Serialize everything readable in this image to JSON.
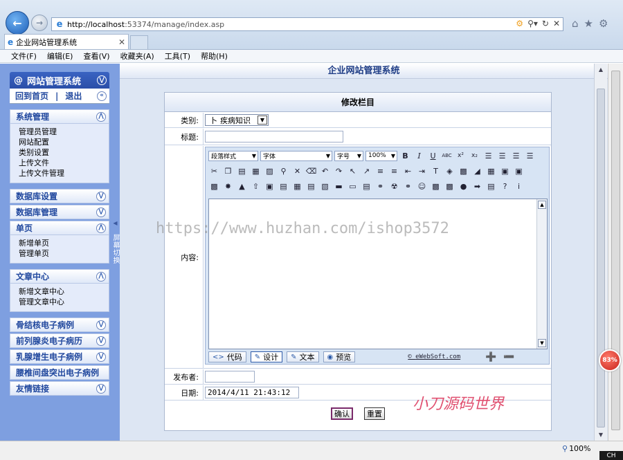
{
  "browser": {
    "url_host": "http://localhost",
    "url_rest": ":53374/manage/index.asp",
    "tab_title": "企业网站管理系统",
    "menu": [
      "文件(F)",
      "编辑(E)",
      "查看(V)",
      "收藏夹(A)",
      "工具(T)",
      "帮助(H)"
    ],
    "zoom": "100%",
    "lang": "CH",
    "progress_badge": "83%"
  },
  "sidebar": {
    "system_title": "网站管理系统",
    "home": "回到首页",
    "separator": "|",
    "logout": "退出",
    "splitter_label": "屏幕切换",
    "sections": [
      {
        "title": "系统管理",
        "expanded": true,
        "items": [
          "管理员管理",
          "网站配置",
          "类别设置",
          "上传文件",
          "上传文件管理"
        ]
      },
      {
        "title": "数据库设置",
        "expanded": false,
        "items": []
      },
      {
        "title": "数据库管理",
        "expanded": false,
        "items": []
      },
      {
        "title": "单页",
        "expanded": true,
        "items": [
          "新增单页",
          "管理单页"
        ]
      },
      {
        "title": "文章中心",
        "expanded": true,
        "items": [
          "新增文章中心",
          "管理文章中心"
        ]
      },
      {
        "title": "骨结核电子病例",
        "expanded": false,
        "items": []
      },
      {
        "title": "前列腺炎电子病历",
        "expanded": false,
        "items": []
      },
      {
        "title": "乳腺增生电子病例",
        "expanded": false,
        "items": []
      },
      {
        "title": "腰椎间盘突出电子病例",
        "expanded": false,
        "items": []
      },
      {
        "title": "友情链接",
        "expanded": false,
        "items": []
      }
    ]
  },
  "main": {
    "title": "企业网站管理系统",
    "form_title": "修改栏目",
    "category_label": "类别:",
    "category_value": "疾病知识",
    "category_prefix": "卜",
    "title_label": "标题:",
    "title_value": "",
    "content_label": "内容:",
    "publisher_label": "发布者:",
    "publisher_value": "",
    "date_label": "日期:",
    "date_value": "2014/4/11 21:43:12",
    "confirm_button": "确认",
    "reset_button": "重置"
  },
  "editor": {
    "paragraph_style": "段落样式",
    "font": "字体",
    "font_size": "字号",
    "zoom": "100%",
    "modes": [
      "代码",
      "设计",
      "文本",
      "预览"
    ],
    "active_mode": "设计",
    "credit": "eWebSoft.com"
  },
  "overlay": {
    "watermark": "https://www.huzhan.com/ishop3572",
    "signature": "小刀源码世界"
  },
  "colors": {
    "sidebar_bg": "#7e9fe0",
    "accent": "#2a4ea8",
    "main_bg": "#dde6f3",
    "signature": "#e05070"
  }
}
